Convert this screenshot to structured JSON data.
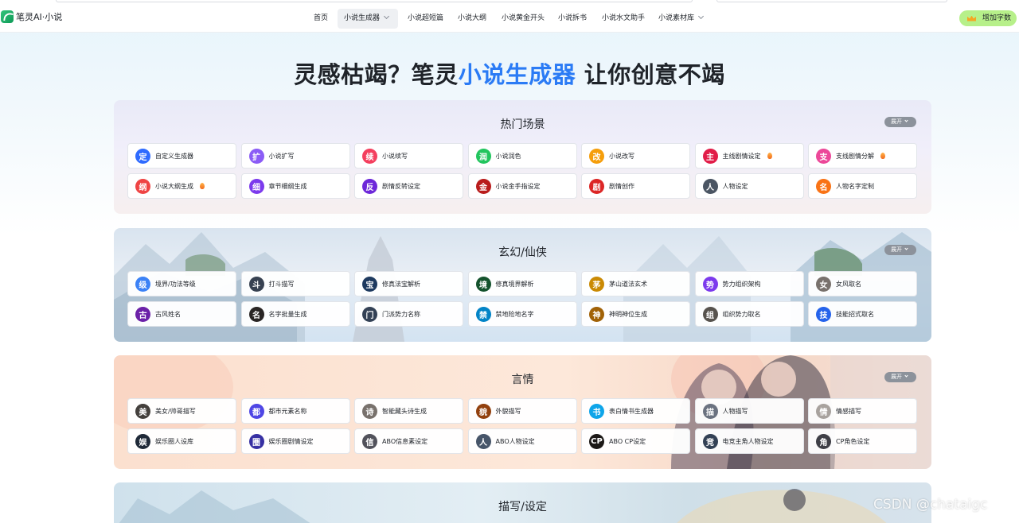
{
  "colors": {
    "accent": "#2b7bf5",
    "add_button": "#b7f08a",
    "expand_badge": "#8c929b"
  },
  "logo": {
    "text": "笔灵AI·小说"
  },
  "nav": {
    "items": [
      {
        "label": "首页",
        "active": false,
        "dropdown": false
      },
      {
        "label": "小说生成器",
        "active": true,
        "dropdown": true
      },
      {
        "label": "小说超短篇",
        "active": false,
        "dropdown": false
      },
      {
        "label": "小说大纲",
        "active": false,
        "dropdown": false
      },
      {
        "label": "小说黄金开头",
        "active": false,
        "dropdown": false
      },
      {
        "label": "小说拆书",
        "active": false,
        "dropdown": false
      },
      {
        "label": "小说水文助手",
        "active": false,
        "dropdown": false
      },
      {
        "label": "小说素材库",
        "active": false,
        "dropdown": true
      }
    ],
    "add_button_label": "增加字数"
  },
  "hero": {
    "part1": "灵感枯竭？笔灵",
    "highlight": "小说生成器",
    "part2": " 让你创意不竭"
  },
  "sections": [
    {
      "title": "热门场景",
      "expand_label": "展开",
      "items": [
        {
          "label": "自定义生成器",
          "icon": "定",
          "color": "#2f6bff",
          "hot": false
        },
        {
          "label": "小说扩写",
          "icon": "扩",
          "color": "#8b5cf6",
          "hot": false
        },
        {
          "label": "小说续写",
          "icon": "续",
          "color": "#f43f5e",
          "hot": false
        },
        {
          "label": "小说润色",
          "icon": "润",
          "color": "#22c55e",
          "hot": false
        },
        {
          "label": "小说改写",
          "icon": "改",
          "color": "#f59e0b",
          "hot": false
        },
        {
          "label": "主线剧情设定",
          "icon": "主",
          "color": "#e11d48",
          "hot": true
        },
        {
          "label": "支线剧情分解",
          "icon": "支",
          "color": "#ec4899",
          "hot": true
        },
        {
          "label": "小说大纲生成",
          "icon": "纲",
          "color": "#ef4444",
          "hot": true
        },
        {
          "label": "章节细纲生成",
          "icon": "细",
          "color": "#7c3aed",
          "hot": false
        },
        {
          "label": "剧情反转设定",
          "icon": "反",
          "color": "#6d28d9",
          "hot": false
        },
        {
          "label": "小说金手指设定",
          "icon": "金",
          "color": "#b91c1c",
          "hot": false
        },
        {
          "label": "剧情创作",
          "icon": "剧",
          "color": "#dc2626",
          "hot": false
        },
        {
          "label": "人物设定",
          "icon": "人",
          "color": "#4b5563",
          "hot": false
        },
        {
          "label": "人物名字定制",
          "icon": "名",
          "color": "#f97316",
          "hot": false
        }
      ]
    },
    {
      "title": "玄幻/仙侠",
      "expand_label": "展开",
      "items": [
        {
          "label": "境界/功法等级",
          "icon": "级",
          "color": "#3b82f6"
        },
        {
          "label": "打斗描写",
          "icon": "斗",
          "color": "#374151"
        },
        {
          "label": "修真法宝解析",
          "icon": "宝",
          "color": "#1e3a5f"
        },
        {
          "label": "修真境界解析",
          "icon": "境",
          "color": "#14532d"
        },
        {
          "label": "茅山道法玄术",
          "icon": "茅",
          "color": "#ca8a04"
        },
        {
          "label": "势力组织架构",
          "icon": "势",
          "color": "#7c3aed"
        },
        {
          "label": "女风取名",
          "icon": "女",
          "color": "#78716c"
        },
        {
          "label": "古风姓名",
          "icon": "古",
          "color": "#6b21a8"
        },
        {
          "label": "名字批量生成",
          "icon": "名",
          "color": "#292524"
        },
        {
          "label": "门派势力名称",
          "icon": "门",
          "color": "#334155"
        },
        {
          "label": "禁地险地名字",
          "icon": "禁",
          "color": "#0284c7"
        },
        {
          "label": "神明神位生成",
          "icon": "神",
          "color": "#a16207"
        },
        {
          "label": "组织势力取名",
          "icon": "组",
          "color": "#57534e"
        },
        {
          "label": "技能招式取名",
          "icon": "技",
          "color": "#2563eb"
        }
      ]
    },
    {
      "title": "言情",
      "expand_label": "展开",
      "items": [
        {
          "label": "美女/帅哥描写",
          "icon": "美",
          "color": "#44403c"
        },
        {
          "label": "都市元素名称",
          "icon": "都",
          "color": "#4f46e5"
        },
        {
          "label": "智能藏头诗生成",
          "icon": "诗",
          "color": "#78716c"
        },
        {
          "label": "外貌描写",
          "icon": "貌",
          "color": "#92400e"
        },
        {
          "label": "表白情书生成器",
          "icon": "书",
          "color": "#0ea5e9"
        },
        {
          "label": "人物描写",
          "icon": "描",
          "color": "#6b7280"
        },
        {
          "label": "情感描写",
          "icon": "情",
          "color": "#a8a29e"
        },
        {
          "label": "娱乐圈人设库",
          "icon": "娱",
          "color": "#1f2937"
        },
        {
          "label": "娱乐圈剧情设定",
          "icon": "圈",
          "color": "#3730a3"
        },
        {
          "label": "ABO信息素设定",
          "icon": "信",
          "color": "#52525b"
        },
        {
          "label": "ABO人物设定",
          "icon": "人",
          "color": "#475569"
        },
        {
          "label": "ABO CP设定",
          "icon": "CP",
          "color": "#1c1917"
        },
        {
          "label": "电竞主角人物设定",
          "icon": "竞",
          "color": "#334155"
        },
        {
          "label": "CP角色设定",
          "icon": "角",
          "color": "#3f3f46"
        }
      ]
    },
    {
      "title": "描写/设定",
      "items": []
    }
  ],
  "watermark": "CSDN @chataigc"
}
